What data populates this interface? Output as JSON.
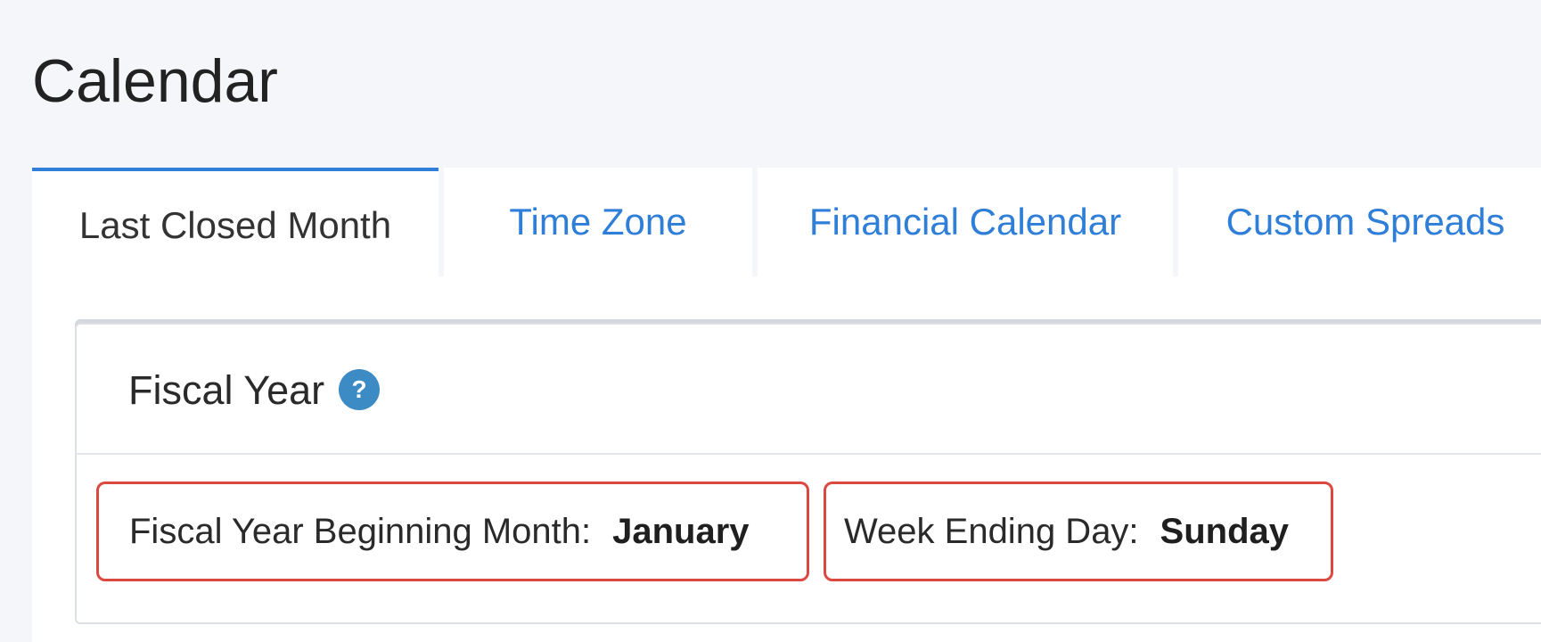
{
  "page": {
    "title": "Calendar"
  },
  "tabs": [
    {
      "label": "Last Closed Month",
      "active": true
    },
    {
      "label": "Time Zone",
      "active": false
    },
    {
      "label": "Financial Calendar",
      "active": false
    },
    {
      "label": "Custom Spreads",
      "active": false
    }
  ],
  "fiscal_year": {
    "title": "Fiscal Year",
    "help_icon": "question-circle-icon",
    "beginning_month_label": "Fiscal Year Beginning Month:",
    "beginning_month_value": "January",
    "week_ending_day_label": "Week Ending Day:",
    "week_ending_day_value": "Sunday"
  },
  "colors": {
    "accent": "#2f7ed8",
    "highlight_border": "#d9493f",
    "help_icon": "#3d8bc4"
  }
}
